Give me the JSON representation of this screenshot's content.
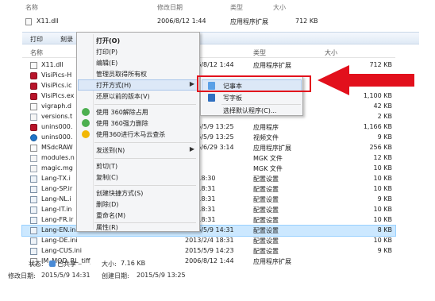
{
  "top_header": {
    "name": "名称",
    "date": "修改日期",
    "type": "类型",
    "size": "大小"
  },
  "top_row": {
    "name": "X11.dll",
    "date": "2006/8/12 1:44",
    "type": "应用程序扩展",
    "size": "712 KB"
  },
  "toolbar": {
    "print": "打印",
    "burn": "刻录"
  },
  "columns": {
    "name": "名称",
    "type": "类型",
    "size": "大小"
  },
  "files": [
    {
      "name": "X11.dll",
      "date": "2006/8/12 1:44",
      "type": "应用程序扩展",
      "size": "712 KB",
      "icon": "dll-file-icon"
    },
    {
      "name": "VisiPics-H",
      "date": "",
      "type": "",
      "size": "",
      "icon": "exe-file-icon"
    },
    {
      "name": "VisiPics.ic",
      "date": "",
      "type": "",
      "size": "",
      "icon": "exe-file-icon"
    },
    {
      "name": "VisiPics.ex",
      "date": "",
      "type": "",
      "size": "1,100 KB",
      "icon": "exe-file-icon"
    },
    {
      "name": "vigraph.d",
      "date": "",
      "type": "",
      "size": "42 KB",
      "icon": "dll-file-icon"
    },
    {
      "name": "versions.t",
      "date": "",
      "type": "",
      "size": "2 KB",
      "icon": "text-file-icon"
    },
    {
      "name": "unins000.",
      "date": "2015/5/9 13:25",
      "type": "应用程序",
      "size": "1,166 KB",
      "icon": "exe-file-icon"
    },
    {
      "name": "unins000.",
      "date": "2015/5/9 13:25",
      "type": "视频文件",
      "size": "9 KB",
      "icon": "video-file-icon"
    },
    {
      "name": "MSdcRAW",
      "date": "2015/6/29 3:14",
      "type": "应用程序扩展",
      "size": "256 KB",
      "icon": "dll-file-icon"
    },
    {
      "name": "modules.n",
      "date": "",
      "type": "MGK 文件",
      "size": "12 KB",
      "icon": "text-file-icon"
    },
    {
      "name": "magic.mg",
      "date": "",
      "type": "MGK 文件",
      "size": "10 KB",
      "icon": "text-file-icon"
    },
    {
      "name": "Lang-TX.i",
      "date": "2/4 18:30",
      "type": "配置设置",
      "size": "10 KB",
      "icon": "config-file-icon"
    },
    {
      "name": "Lang-SP.ir",
      "date": "2/4 18:31",
      "type": "配置设置",
      "size": "10 KB",
      "icon": "config-file-icon"
    },
    {
      "name": "Lang-NL.i",
      "date": "2/4 18:31",
      "type": "配置设置",
      "size": "9 KB",
      "icon": "config-file-icon"
    },
    {
      "name": "Lang-IT.in",
      "date": "2/4 18:31",
      "type": "配置设置",
      "size": "10 KB",
      "icon": "config-file-icon"
    },
    {
      "name": "Lang-FR.ir",
      "date": "2/4 18:31",
      "type": "配置设置",
      "size": "10 KB",
      "icon": "config-file-icon"
    },
    {
      "name": "Lang-EN.ini",
      "date": "2015/5/9 14:31",
      "type": "配置设置",
      "size": "8 KB",
      "icon": "config-file-icon",
      "selected": true
    },
    {
      "name": "Lang-DE.ini",
      "date": "2013/2/4 18:31",
      "type": "配置设置",
      "size": "10 KB",
      "icon": "config-file-icon"
    },
    {
      "name": "Lang-CUS.ini",
      "date": "2015/5/9 14:23",
      "type": "配置设置",
      "size": "9 KB",
      "icon": "config-file-icon"
    },
    {
      "name": "IM_MOD_RL_tiff_.dll",
      "date": "2006/8/12 1:44",
      "type": "应用程序扩展",
      "size": "",
      "icon": "dll-file-icon"
    }
  ],
  "status": {
    "state_label": "状态:",
    "state_value": "已共享",
    "size_label": "大小:",
    "size_value": "7.16 KB",
    "modified_label": "修改日期:",
    "modified_value": "2015/5/9 14:31",
    "created_label": "创建日期:",
    "created_value": "2015/5/9 13:25"
  },
  "context_menu": [
    "打开(O)",
    "打印(P)",
    "编辑(E)",
    "管理员取得所有权",
    "打开方式(H)",
    "还原以前的版本(V)",
    "使用 360解除占用",
    "使用 360强力删除",
    "使用360进行木马云查杀",
    "发送到(N)",
    "剪切(T)",
    "复制(C)",
    "创建快捷方式(S)",
    "删除(D)",
    "重命名(M)",
    "属性(R)"
  ],
  "open_with_menu": [
    "记事本",
    "写字板",
    "选择默认程序(C)..."
  ],
  "colors": {
    "highlight_red": "#e2101c",
    "selection_blue": "#cce8ff"
  }
}
